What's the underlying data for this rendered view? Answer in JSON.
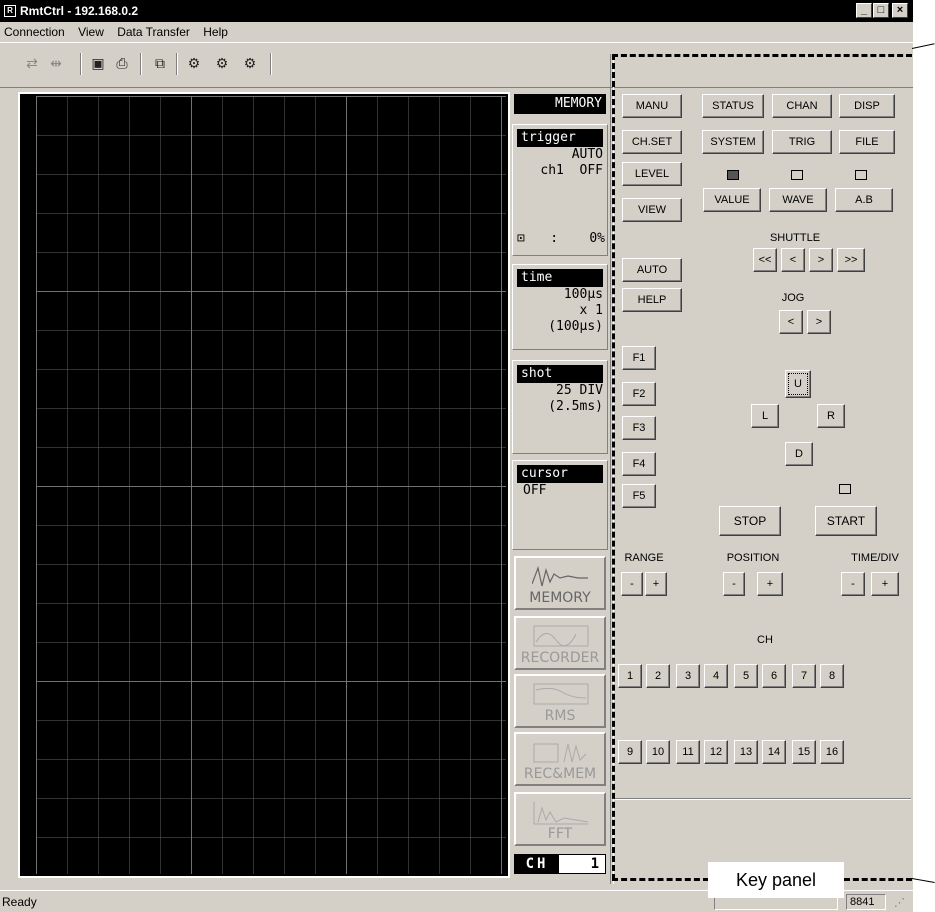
{
  "window": {
    "title": "RmtCtrl - 192.168.0.2"
  },
  "menu": [
    "Connection",
    "View",
    "Data Transfer",
    "Help"
  ],
  "side_panel": {
    "mode": "MEMORY",
    "trigger": {
      "head": "trigger",
      "mode": "AUTO",
      "channel": "ch1",
      "state": "OFF",
      "pretrig_symbol": "⊡",
      "pretrig_value": ":    0%"
    },
    "time": {
      "head": "time",
      "value": "100μs",
      "mult": "x 1",
      "paren": "(100μs)"
    },
    "shot": {
      "head": "shot",
      "value": "25 DIV",
      "paren": "(2.5ms)"
    },
    "cursor": {
      "head": "cursor",
      "value": "OFF"
    },
    "modes": [
      "MEMORY",
      "RECORDER",
      "RMS",
      "REC&MEM",
      "FFT"
    ],
    "ch_label": "CH",
    "ch_value": "1"
  },
  "key_panel": {
    "row1": [
      "MANU",
      "STATUS",
      "CHAN",
      "DISP"
    ],
    "row2": [
      "CH.SET",
      "SYSTEM",
      "TRIG",
      "FILE"
    ],
    "level": "LEVEL",
    "view": "VIEW",
    "disp_modes": [
      "VALUE",
      "WAVE",
      "A.B"
    ],
    "shuttle_label": "SHUTTLE",
    "shuttle": [
      "<<",
      "<",
      ">",
      ">>"
    ],
    "auto": "AUTO",
    "help": "HELP",
    "jog_label": "JOG",
    "jog": [
      "<",
      ">"
    ],
    "fkeys": [
      "F1",
      "F2",
      "F3",
      "F4",
      "F5"
    ],
    "dir": {
      "u": "U",
      "l": "L",
      "r": "R",
      "d": "D"
    },
    "stop": "STOP",
    "start": "START",
    "range": "RANGE",
    "position": "POSITION",
    "timediv": "TIME/DIV",
    "minus": "-",
    "plus": "+",
    "ch_label": "CH",
    "ch_row1": [
      "1",
      "2",
      "3",
      "4",
      "5",
      "6",
      "7",
      "8"
    ],
    "ch_row2": [
      "9",
      "10",
      "11",
      "12",
      "13",
      "14",
      "15",
      "16"
    ]
  },
  "status": {
    "text": "Ready",
    "model": "8841"
  },
  "callout": "Key panel"
}
